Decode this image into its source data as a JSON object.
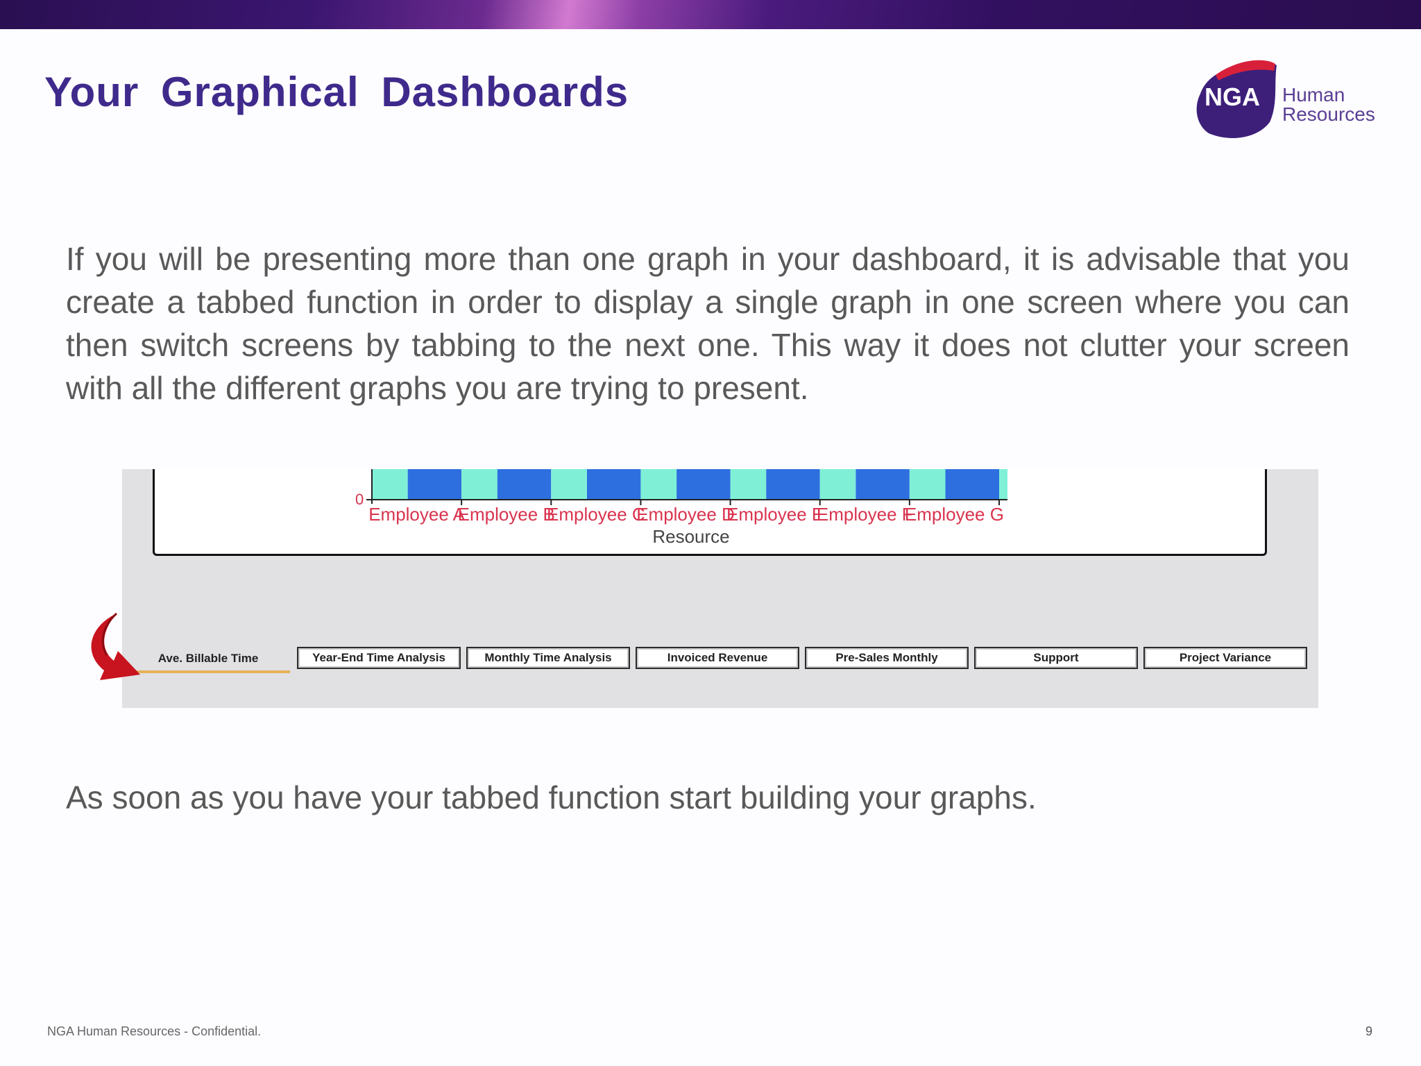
{
  "slide": {
    "title": "Your  Graphical  Dashboards",
    "paragraph": "If you will be presenting more than one graph in your dashboard, it is advisable that you create a tabbed function in order to display a single graph in one screen where you can then switch screens by tabbing to the next one. This way it does not clutter your screen with all the different graphs you are trying to present.",
    "closing": "As soon as you have your tabbed function start building your graphs.",
    "footer_left": "NGA Human Resources - Confidential.",
    "page_number": "9"
  },
  "logo": {
    "mark_text": "NGA",
    "line1": "Human",
    "line2": "Resources",
    "colors": {
      "purple": "#3d1f7a",
      "red": "#d8203a"
    }
  },
  "chart_data": {
    "type": "bar",
    "categories": [
      "Employee A",
      "Employee B",
      "Employee C",
      "Employee D",
      "Employee E",
      "Employee F",
      "Employee G"
    ],
    "xlabel": "Resource",
    "ylabel": "",
    "y_tick_labels": [
      "0"
    ],
    "series": [
      {
        "color": "#7ff0d6"
      },
      {
        "color": "#2e6fe0"
      }
    ],
    "note": "Chart is cropped; only bar bases near 0 are visible, values not readable."
  },
  "tabs": [
    {
      "label": "Ave. Billable Time",
      "active": true
    },
    {
      "label": "Year-End Time Analysis",
      "active": false
    },
    {
      "label": "Monthly Time Analysis",
      "active": false
    },
    {
      "label": "Invoiced Revenue",
      "active": false
    },
    {
      "label": "Pre-Sales Monthly",
      "active": false
    },
    {
      "label": "Support",
      "active": false
    },
    {
      "label": "Project Variance",
      "active": false
    }
  ],
  "colors": {
    "title": "#3f2a8c",
    "body_text": "#595959",
    "category_label": "#d9344f",
    "arrow": "#c8141e"
  }
}
